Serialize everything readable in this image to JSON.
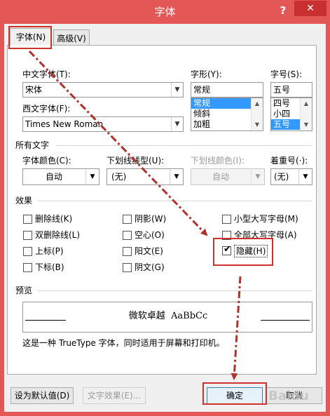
{
  "window": {
    "title": "字体",
    "help_label": "?",
    "close_label": "✕"
  },
  "tabs": [
    {
      "label": "字体(N)",
      "active": true
    },
    {
      "label": "高级(V)",
      "active": false
    }
  ],
  "chinese_font": {
    "label": "中文字体(T):",
    "value": "宋体"
  },
  "western_font": {
    "label": "西文字体(F):",
    "value": "Times New Roman"
  },
  "style": {
    "label": "字形(Y):",
    "value": "常规",
    "options": [
      "常规",
      "倾斜",
      "加粗"
    ],
    "selected": 0
  },
  "size": {
    "label": "字号(S):",
    "value": "五号",
    "options": [
      "四号",
      "小四",
      "五号"
    ],
    "selected": 2
  },
  "all_text": {
    "title": "所有文字",
    "font_color": {
      "label": "字体颜色(C):",
      "value": "自动"
    },
    "underline_style": {
      "label": "下划线线型(U):",
      "value": "(无)"
    },
    "underline_color": {
      "label": "下划线颜色(I):",
      "value": "自动",
      "disabled": true
    },
    "emphasis": {
      "label": "着重号(·):",
      "value": "(无)"
    }
  },
  "effects": {
    "title": "效果",
    "items": [
      {
        "label": "删除线(K)",
        "checked": false
      },
      {
        "label": "双删除线(L)",
        "checked": false
      },
      {
        "label": "上标(P)",
        "checked": false
      },
      {
        "label": "下标(B)",
        "checked": false
      },
      {
        "label": "阴影(W)",
        "checked": false
      },
      {
        "label": "空心(O)",
        "checked": false
      },
      {
        "label": "阳文(E)",
        "checked": false
      },
      {
        "label": "阴文(G)",
        "checked": false
      },
      {
        "label": "小型大写字母(M)",
        "checked": false
      },
      {
        "label": "全部大写字母(A)",
        "checked": false
      },
      {
        "label": "隐藏(H)",
        "checked": true
      }
    ]
  },
  "preview": {
    "title": "预览",
    "sample": "微软卓越  AaBbCc",
    "note": "这是一种 TrueType 字体，同时适用于屏幕和打印机。"
  },
  "buttons": {
    "set_default": "设为默认值(D)",
    "text_effects": "文字效果(E)...",
    "ok": "确定",
    "cancel": "取消"
  },
  "watermark": "Baidu",
  "colors": {
    "titlebar": "#e45757",
    "close": "#c7302e",
    "selection": "#3399ff",
    "annotation": "#b0302a"
  }
}
